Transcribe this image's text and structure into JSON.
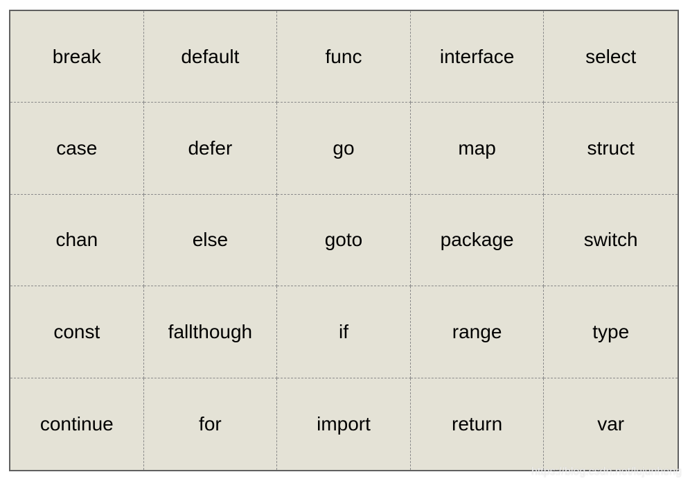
{
  "table": {
    "rows": [
      [
        "break",
        "default",
        "func",
        "interface",
        "select"
      ],
      [
        "case",
        "defer",
        "go",
        "map",
        "struct"
      ],
      [
        "chan",
        "else",
        "goto",
        "package",
        "switch"
      ],
      [
        "const",
        "fallthough",
        "if",
        "range",
        "type"
      ],
      [
        "continue",
        "for",
        "import",
        "return",
        "var"
      ]
    ]
  },
  "colors": {
    "cell_background": "#e4e2d6",
    "border": "#606060"
  },
  "watermark": "https://blog.csdn.net/lujunheng"
}
